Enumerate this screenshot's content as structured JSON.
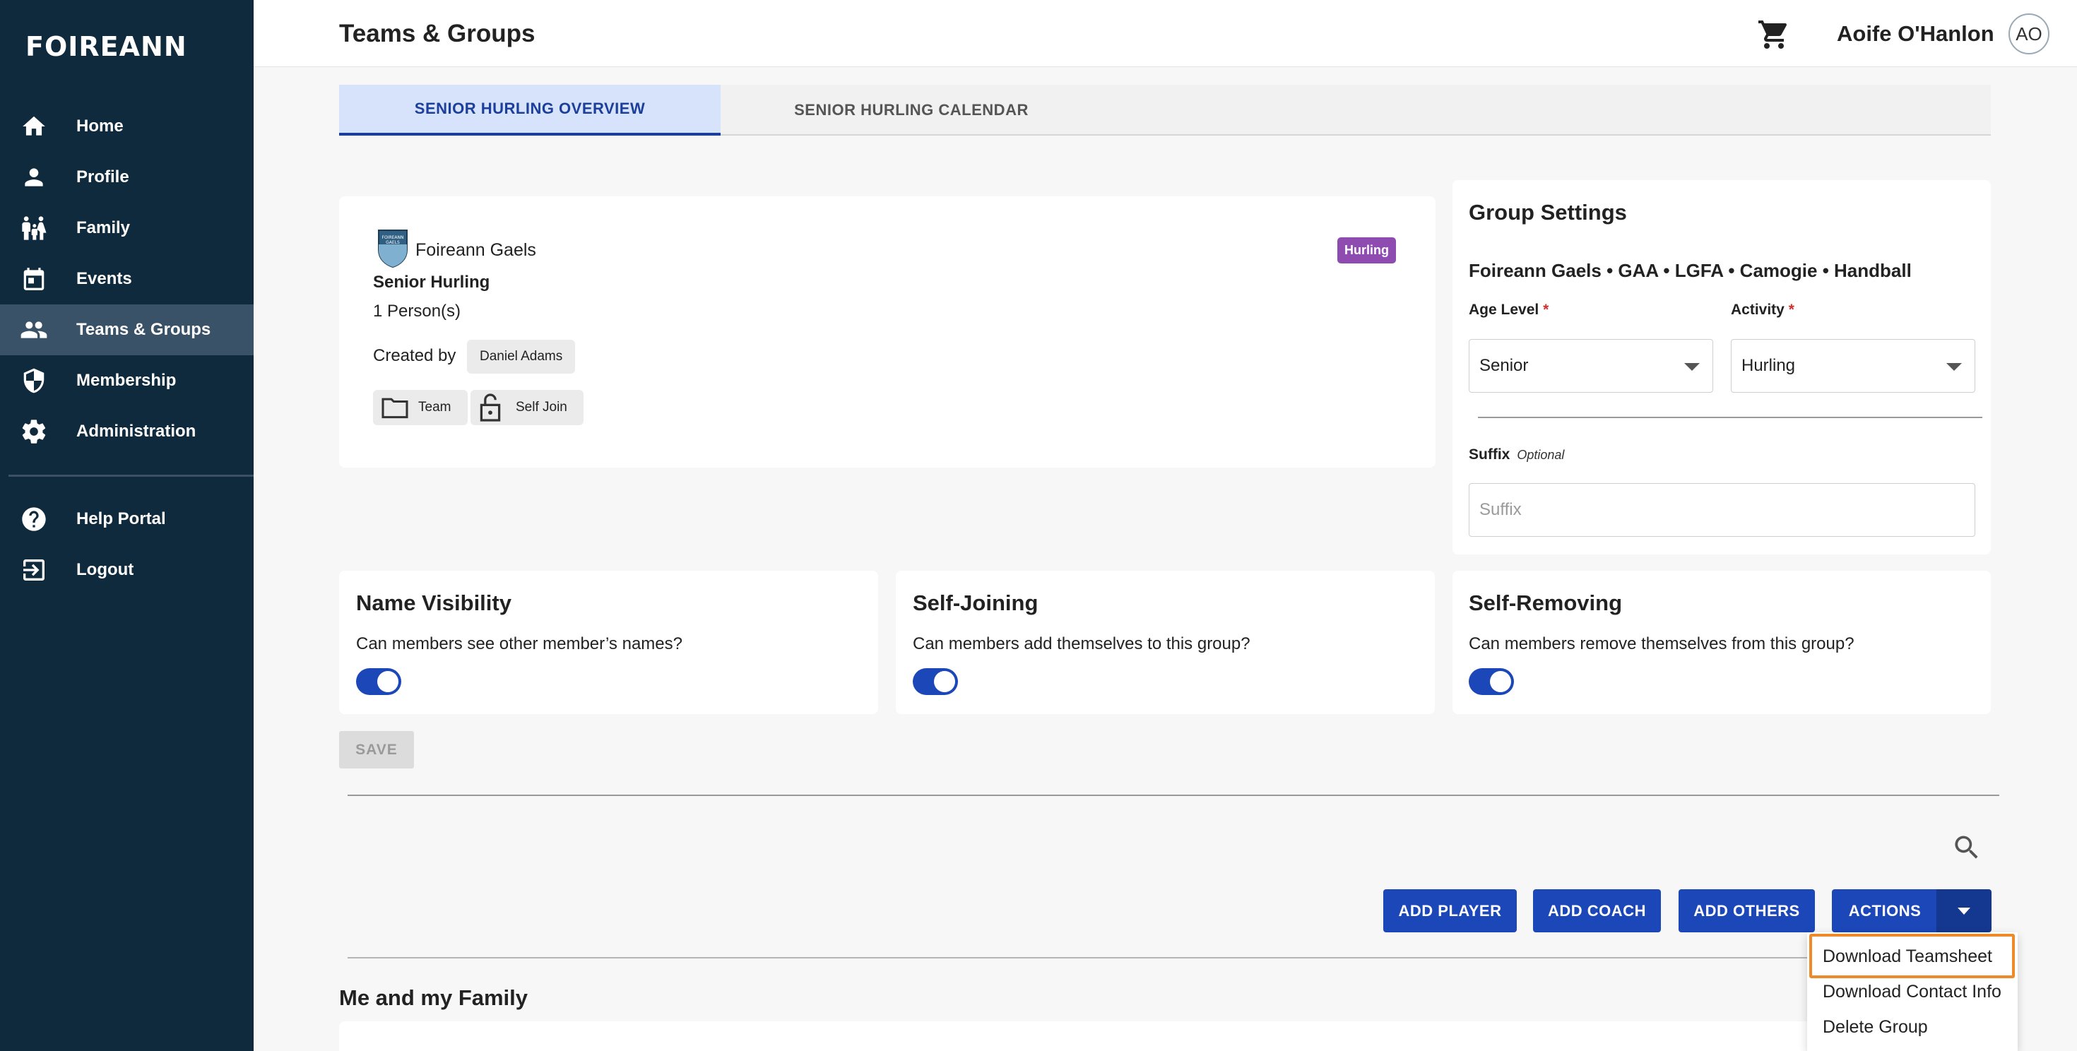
{
  "sidebar": {
    "brand": "FOIREANN",
    "items": [
      {
        "label": "Home",
        "icon": "home-icon"
      },
      {
        "label": "Profile",
        "icon": "person-icon"
      },
      {
        "label": "Family",
        "icon": "family-icon"
      },
      {
        "label": "Events",
        "icon": "calendar-icon"
      },
      {
        "label": "Teams & Groups",
        "icon": "group-icon",
        "active": true
      },
      {
        "label": "Membership",
        "icon": "shield-icon"
      },
      {
        "label": "Administration",
        "icon": "gear-icon"
      }
    ],
    "secondary": [
      {
        "label": "Help Portal",
        "icon": "help-icon"
      },
      {
        "label": "Logout",
        "icon": "logout-icon"
      }
    ]
  },
  "header": {
    "title": "Teams & Groups",
    "user_name": "Aoife O'Hanlon",
    "avatar_initials": "AO"
  },
  "tabs": [
    {
      "label": "SENIOR HURLING OVERVIEW",
      "active": true
    },
    {
      "label": "SENIOR HURLING CALENDAR",
      "active": false
    }
  ],
  "group_card": {
    "club_name": "Foireann Gaels",
    "crest_text": "FOIREANN GAELS",
    "sport_badge": "Hurling",
    "group_name": "Senior Hurling",
    "member_count": "1 Person(s)",
    "created_by_label": "Created by",
    "created_by": "Daniel Adams",
    "chips": [
      {
        "label": "Team",
        "icon": "folder-icon"
      },
      {
        "label": "Self Join",
        "icon": "lock-open-icon"
      }
    ]
  },
  "group_settings": {
    "title": "Group Settings",
    "orgs": "Foireann Gaels • GAA • LGFA • Camogie • Handball",
    "age_level_label": "Age Level",
    "age_level_value": "Senior",
    "activity_label": "Activity",
    "activity_value": "Hurling",
    "required_mark": "*",
    "suffix_label": "Suffix",
    "suffix_optional": "Optional",
    "suffix_placeholder": "Suffix"
  },
  "options": [
    {
      "title": "Name Visibility",
      "desc": "Can members see other member’s names?",
      "enabled": true
    },
    {
      "title": "Self-Joining",
      "desc": "Can members add themselves to this group?",
      "enabled": true
    },
    {
      "title": "Self-Removing",
      "desc": "Can members remove themselves from this group?",
      "enabled": true
    }
  ],
  "save_label": "SAVE",
  "actions": {
    "add_player": "ADD PLAYER",
    "add_coach": "ADD COACH",
    "add_others": "ADD OTHERS",
    "actions": "ACTIONS"
  },
  "dropdown": {
    "items": [
      "Download Teamsheet",
      "Download Contact Info",
      "Delete Group"
    ],
    "highlighted": "Download Teamsheet"
  },
  "members_section_title": "Me and my Family",
  "colors": {
    "sidebar_bg": "#0f2a3c",
    "sidebar_active": "#3a5268",
    "primary": "#1c47b8",
    "badge": "#8e4bb0",
    "highlight": "#ef8a2a"
  }
}
